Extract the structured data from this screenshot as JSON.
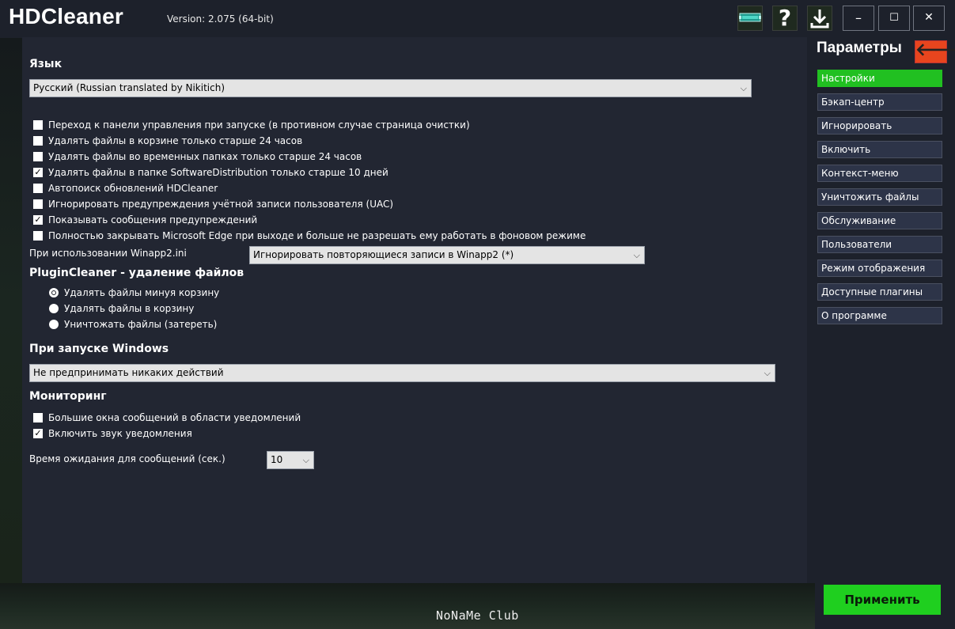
{
  "app": {
    "title": "HDCleaner",
    "version": "Version: 2.075 (64-bit)"
  },
  "toolbar": {
    "icons": [
      "monitor-icon",
      "help-icon",
      "download-icon"
    ],
    "help_glyph": "?",
    "download_glyph": "⤓",
    "minimize_glyph": "–",
    "maximize_glyph": "☐",
    "close_glyph": "✕"
  },
  "language": {
    "title": "Язык",
    "selected": "Русский (Russian translated by Nikitich)"
  },
  "options": [
    {
      "label": "Переход к панели управления при запуске (в противном случае страница очистки)",
      "checked": false
    },
    {
      "label": "Удалять файлы в корзине только старше 24 часов",
      "checked": false
    },
    {
      "label": "Удалять файлы во временных папках только старше 24 часов",
      "checked": false
    },
    {
      "label": "Удалять файлы в папке SoftwareDistribution только старше 10 дней",
      "checked": true
    },
    {
      "label": "Автопоиск обновлений HDCleaner",
      "checked": false
    },
    {
      "label": "Игнорировать предупреждения учётной записи пользователя (UAC)",
      "checked": false
    },
    {
      "label": "Показывать сообщения предупреждений",
      "checked": true
    },
    {
      "label": "Полностью закрывать Microsoft Edge при выходе и больше не разрешать ему работать в фоновом режиме",
      "checked": false
    }
  ],
  "winapp": {
    "label": "При использовании Winapp2.ini",
    "selected": "Игнорировать повторяющиеся записи в Winapp2 (*)"
  },
  "plugincleaner": {
    "title": "PluginCleaner - удаление файлов",
    "radios": [
      {
        "label": "Удалять файлы минуя корзину",
        "selected": true
      },
      {
        "label": "Удалять файлы в корзину",
        "selected": false
      },
      {
        "label": "Уничтожать файлы (затереть)",
        "selected": false
      }
    ]
  },
  "startup": {
    "title": "При запуске Windows",
    "selected": "Не предпринимать никаких действий"
  },
  "monitoring": {
    "title": "Мониторинг",
    "options": [
      {
        "label": "Большие окна сообщений в области уведомлений",
        "checked": false
      },
      {
        "label": "Включить звук уведомления",
        "checked": true
      }
    ],
    "timeout_label": "Время ожидания для сообщений (сек.)",
    "timeout_value": "10"
  },
  "sidebar": {
    "title": "Параметры",
    "back_glyph": "🡐",
    "items": [
      {
        "label": "Настройки",
        "active": true
      },
      {
        "label": "Бэкап-центр",
        "active": false
      },
      {
        "label": "Игнорировать",
        "active": false
      },
      {
        "label": "Включить",
        "active": false
      },
      {
        "label": "Контекст-меню",
        "active": false
      },
      {
        "label": "Уничтожить файлы",
        "active": false
      },
      {
        "label": "Обслуживание",
        "active": false
      },
      {
        "label": "Пользователи",
        "active": false
      },
      {
        "label": "Режим отображения",
        "active": false
      },
      {
        "label": "Доступные плагины",
        "active": false
      },
      {
        "label": "О программе",
        "active": false
      }
    ]
  },
  "apply_label": "Применить",
  "watermark": "NoNaMe Club",
  "colors": {
    "accent_green": "#21c021",
    "back_red": "#e8451e",
    "panel": "#222632",
    "background": "#1d212b"
  }
}
